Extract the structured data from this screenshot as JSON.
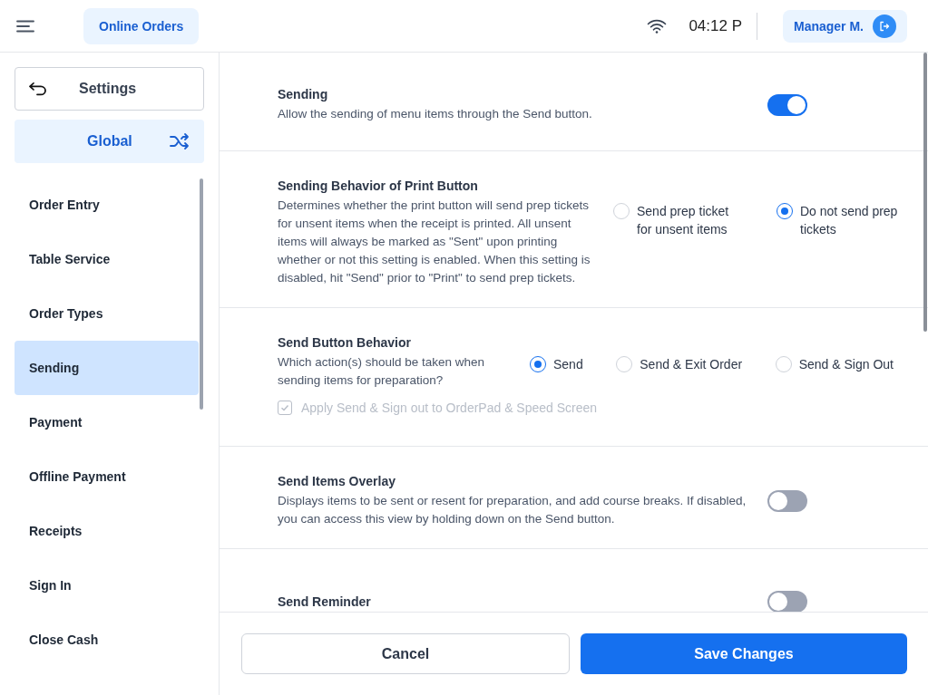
{
  "header": {
    "location_button": "Online Orders",
    "time": "04:12 P",
    "user_button": "Manager M."
  },
  "sidebar": {
    "back_button": "Settings",
    "scope_button": "Global",
    "items": [
      {
        "label": "Order Entry",
        "selected": false
      },
      {
        "label": "Table Service",
        "selected": false
      },
      {
        "label": "Order Types",
        "selected": false
      },
      {
        "label": "Sending",
        "selected": true
      },
      {
        "label": "Payment",
        "selected": false
      },
      {
        "label": "Offline Payment",
        "selected": false
      },
      {
        "label": "Receipts",
        "selected": false
      },
      {
        "label": "Sign In",
        "selected": false
      },
      {
        "label": "Close Cash",
        "selected": false
      }
    ]
  },
  "sections": [
    {
      "kind": "toggle",
      "title": "Sending",
      "description": "Allow the sending of menu items through the Send button.",
      "on": true
    },
    {
      "kind": "radio",
      "title": "Sending Behavior of Print Button",
      "description": "Determines whether the print button will send prep tickets for unsent items when the receipt is printed. All unsent items will always be marked as \"Sent\" upon printing whether or not this setting is enabled. When this setting is disabled, hit \"Send\" prior to \"Print\" to send prep tickets.",
      "options": [
        {
          "label": "Send prep ticket for unsent items",
          "selected": false
        },
        {
          "label": "Do not send prep tickets",
          "selected": true
        }
      ]
    },
    {
      "kind": "radio",
      "title": "Send Button Behavior",
      "description": "Which action(s) should be taken when sending items for preparation?",
      "options": [
        {
          "label": "Send",
          "selected": true
        },
        {
          "label": "Send & Exit Order",
          "selected": false
        },
        {
          "label": "Send & Sign Out",
          "selected": false
        }
      ],
      "checkbox": {
        "label": "Apply Send & Sign out to OrderPad & Speed Screen",
        "checked": true,
        "disabled": true
      }
    },
    {
      "kind": "toggle",
      "title": "Send Items Overlay",
      "description": "Displays items to be sent or resent for preparation, and add course breaks. If disabled, you can access this view by holding down on the Send button.",
      "on": false
    },
    {
      "kind": "toggle",
      "title": "Send Reminder",
      "on": false
    }
  ],
  "footer": {
    "cancel_button": "Cancel",
    "save_button": "Save Changes"
  }
}
